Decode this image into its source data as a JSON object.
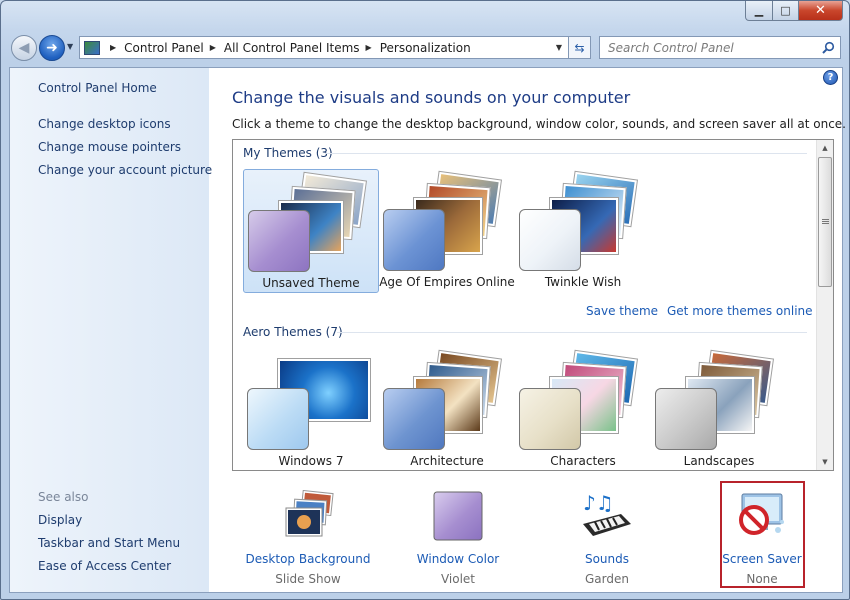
{
  "window": {
    "caption": {
      "minimize": "▁",
      "maximize": "□",
      "close": "✕"
    }
  },
  "nav": {
    "back_icon": "arrow-left-icon",
    "forward_icon": "arrow-right-icon",
    "breadcrumbs": [
      "Control Panel",
      "All Control Panel Items",
      "Personalization"
    ]
  },
  "search": {
    "placeholder": "Search Control Panel",
    "value": ""
  },
  "sidebar": {
    "home": "Control Panel Home",
    "links": [
      "Change desktop icons",
      "Change mouse pointers",
      "Change your account picture"
    ],
    "see_also_label": "See also",
    "see_also": [
      "Display",
      "Taskbar and Start Menu",
      "Ease of Access Center"
    ]
  },
  "main": {
    "help": "?",
    "title": "Change the visuals and sounds on your computer",
    "description": "Click a theme to change the desktop background, window color, sounds, and screen saver all at once."
  },
  "themes": {
    "my_group": "My Themes (3)",
    "my_themes": [
      {
        "name": "Unsaved Theme",
        "selected": true,
        "color": "#a68ed0"
      },
      {
        "name": "Age Of Empires Online",
        "selected": false,
        "color": "#6c93d4"
      },
      {
        "name": "Twinkle Wish",
        "selected": false,
        "color": "#eef3f8"
      }
    ],
    "save_theme": "Save theme",
    "get_more": "Get more themes online",
    "aero_group": "Aero Themes (7)",
    "aero_themes": [
      {
        "name": "Windows 7",
        "color": "#bcdcf5"
      },
      {
        "name": "Architecture",
        "color": "#6e94d0"
      },
      {
        "name": "Characters",
        "color": "#e7e0c8"
      },
      {
        "name": "Landscapes",
        "color": "#c9c9c9"
      }
    ]
  },
  "settings": [
    {
      "label": "Desktop Background",
      "value": "Slide Show",
      "icon": "desktop-background-icon"
    },
    {
      "label": "Window Color",
      "value": "Violet",
      "icon": "window-color-icon"
    },
    {
      "label": "Sounds",
      "value": "Garden",
      "icon": "sounds-icon"
    },
    {
      "label": "Screen Saver",
      "value": "None",
      "icon": "screen-saver-icon"
    }
  ]
}
